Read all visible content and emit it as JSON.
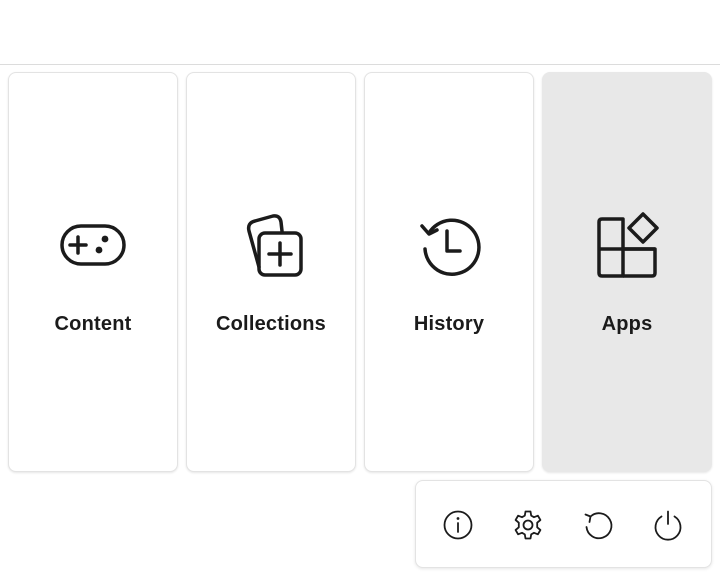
{
  "tiles": [
    {
      "label": "Content",
      "icon": "gamepad-icon"
    },
    {
      "label": "Collections",
      "icon": "collections-add-icon"
    },
    {
      "label": "History",
      "icon": "history-clock-icon"
    },
    {
      "label": "Apps",
      "icon": "apps-grid-icon",
      "selected": true
    }
  ],
  "power_bar": {
    "buttons": [
      {
        "icon": "info-icon"
      },
      {
        "icon": "gear-icon"
      },
      {
        "icon": "restart-icon"
      },
      {
        "icon": "power-icon"
      }
    ]
  },
  "colors": {
    "selected_tile": "#e8e8e8",
    "icon": "#1b1b1b",
    "border": "#e3e3e3"
  }
}
